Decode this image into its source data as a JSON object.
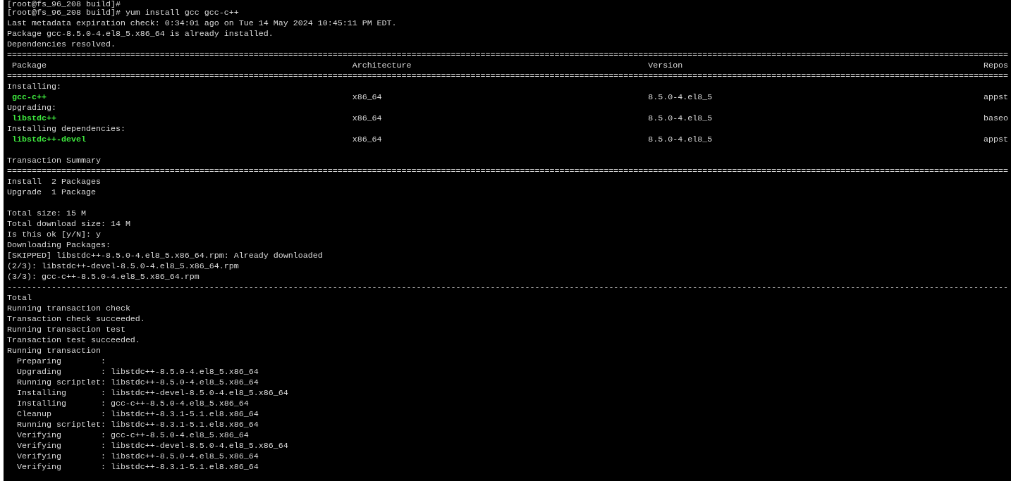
{
  "terminal": {
    "lines": [
      {
        "kind": "text",
        "text": "[root@fs_96_208 build]#"
      },
      {
        "kind": "text",
        "text": "[root@fs_96_208 build]# yum install gcc gcc-c++"
      },
      {
        "kind": "text",
        "text": "Last metadata expiration check: 0:34:01 ago on Tue 14 May 2024 10:45:11 PM EDT."
      },
      {
        "kind": "text",
        "text": "Package gcc-8.5.0-4.el8_5.x86_64 is already installed."
      },
      {
        "kind": "text",
        "text": "Dependencies resolved."
      },
      {
        "kind": "rule",
        "text": "==========================================================================================================================================================================================================="
      },
      {
        "kind": "header",
        "cells": [
          "Package",
          "Architecture",
          "Version",
          "Repos"
        ]
      },
      {
        "kind": "rule",
        "text": "==========================================================================================================================================================================================================="
      },
      {
        "kind": "text",
        "text": "Installing:"
      },
      {
        "kind": "package",
        "cells": [
          "gcc-c++",
          "x86_64",
          "8.5.0-4.el8_5",
          "appst"
        ]
      },
      {
        "kind": "text",
        "text": "Upgrading:"
      },
      {
        "kind": "package",
        "cells": [
          "libstdc++",
          "x86_64",
          "8.5.0-4.el8_5",
          "baseo"
        ]
      },
      {
        "kind": "text",
        "text": "Installing dependencies:"
      },
      {
        "kind": "package",
        "cells": [
          "libstdc++-devel",
          "x86_64",
          "8.5.0-4.el8_5",
          "appst"
        ]
      },
      {
        "kind": "blank"
      },
      {
        "kind": "text",
        "text": "Transaction Summary"
      },
      {
        "kind": "rule",
        "text": "==========================================================================================================================================================================================================="
      },
      {
        "kind": "text",
        "text": "Install  2 Packages"
      },
      {
        "kind": "text",
        "text": "Upgrade  1 Package"
      },
      {
        "kind": "blank"
      },
      {
        "kind": "text",
        "text": "Total size: 15 M"
      },
      {
        "kind": "text",
        "text": "Total download size: 14 M"
      },
      {
        "kind": "text",
        "text": "Is this ok [y/N]: y"
      },
      {
        "kind": "text",
        "text": "Downloading Packages:"
      },
      {
        "kind": "text",
        "text": "[SKIPPED] libstdc++-8.5.0-4.el8_5.x86_64.rpm: Already downloaded"
      },
      {
        "kind": "text",
        "text": "(2/3): libstdc++-devel-8.5.0-4.el8_5.x86_64.rpm"
      },
      {
        "kind": "text",
        "text": "(3/3): gcc-c++-8.5.0-4.el8_5.x86_64.rpm"
      },
      {
        "kind": "rule",
        "text": "-----------------------------------------------------------------------------------------------------------------------------------------------------------------------------------------------------------"
      },
      {
        "kind": "text",
        "text": "Total"
      },
      {
        "kind": "text",
        "text": "Running transaction check"
      },
      {
        "kind": "text",
        "text": "Transaction check succeeded."
      },
      {
        "kind": "text",
        "text": "Running transaction test"
      },
      {
        "kind": "text",
        "text": "Transaction test succeeded."
      },
      {
        "kind": "text",
        "text": "Running transaction"
      },
      {
        "kind": "step",
        "text": "Preparing        :"
      },
      {
        "kind": "step",
        "text": "Upgrading        : libstdc++-8.5.0-4.el8_5.x86_64"
      },
      {
        "kind": "step",
        "text": "Running scriptlet: libstdc++-8.5.0-4.el8_5.x86_64"
      },
      {
        "kind": "step",
        "text": "Installing       : libstdc++-devel-8.5.0-4.el8_5.x86_64"
      },
      {
        "kind": "step",
        "text": "Installing       : gcc-c++-8.5.0-4.el8_5.x86_64"
      },
      {
        "kind": "step",
        "text": "Cleanup          : libstdc++-8.3.1-5.1.el8.x86_64"
      },
      {
        "kind": "step",
        "text": "Running scriptlet: libstdc++-8.3.1-5.1.el8.x86_64"
      },
      {
        "kind": "step",
        "text": "Verifying        : gcc-c++-8.5.0-4.el8_5.x86_64"
      },
      {
        "kind": "step",
        "text": "Verifying        : libstdc++-devel-8.5.0-4.el8_5.x86_64"
      },
      {
        "kind": "step",
        "text": "Verifying        : libstdc++-8.5.0-4.el8_5.x86_64"
      },
      {
        "kind": "step",
        "text": "Verifying        : libstdc++-8.3.1-5.1.el8.x86_64"
      }
    ]
  }
}
